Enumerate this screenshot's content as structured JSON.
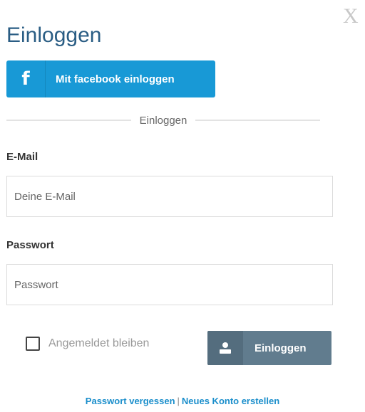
{
  "modal": {
    "close_label": "X",
    "title": "Einloggen"
  },
  "facebook": {
    "icon_glyph": "f",
    "label": "Mit facebook einloggen"
  },
  "divider_label": "Einloggen",
  "email": {
    "label": "E-Mail",
    "placeholder": "Deine E-Mail",
    "value": ""
  },
  "password": {
    "label": "Passwort",
    "placeholder": "Passwort",
    "value": ""
  },
  "remember": {
    "label": "Angemeldet bleiben",
    "checked": false
  },
  "login_button": {
    "label": "Einloggen"
  },
  "links": {
    "forgot": "Passwort vergessen",
    "separator": "|",
    "register": "Neues Konto erstellen"
  },
  "colors": {
    "title": "#2a5d84",
    "facebook": "#1899d6",
    "login_button": "#617c8e",
    "link": "#1a8ecb"
  }
}
